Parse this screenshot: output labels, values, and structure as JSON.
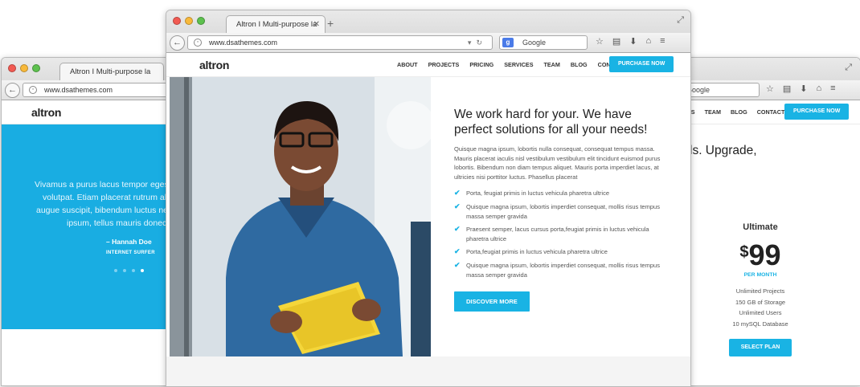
{
  "browser": {
    "tab_title": "Altron I Multi-purpose la",
    "tab_title_short": "Altron I Multi-purpose la",
    "url": "www.dsathemes.com",
    "search_placeholder": "Google",
    "search_engine_icon": "google-icon"
  },
  "site": {
    "logo": "altron",
    "nav": [
      "ABOUT",
      "PROJECTS",
      "PRICING",
      "SERVICES",
      "TEAM",
      "BLOG",
      "CONTACTS"
    ],
    "nav_right_visible": [
      "ES",
      "TEAM",
      "BLOG",
      "CONTACTS"
    ],
    "purchase_label": "PURCHASE NOW",
    "accent": "#19b3e4"
  },
  "main": {
    "heading": "We work hard for your. We have perfect solutions for all your needs!",
    "paragraph": "Quisque magna ipsum, lobortis nulla consequat, consequat tempus massa. Mauris placerat iaculis nisl vestibulum vestibulum elit tincidunt euismod purus lobortis. Bibendum non diam tempus aliquet. Mauris porta imperdiet lacus, at ultricies nisi porttitor luctus. Phasellus placerat",
    "list": [
      "Porta, feugiat primis in luctus vehicula pharetra ultrice",
      "Quisque magna ipsum, lobortis imperdiet consequat, mollis risus tempus massa semper gravida",
      "Praesent semper, lacus cursus porta,feugiat primis in luctus vehicula pharetra ultrice",
      "Porta,feugiat primis in luctus vehicula pharetra ultrice",
      "Quisque magna ipsum, lobortis imperdiet consequat, mollis risus tempus massa semper gravida"
    ],
    "cta": "DISCOVER MORE"
  },
  "testimonial": {
    "lines": [
      "Vivamus a purus lacus tempor egestas",
      "volutpat. Etiam placerat rutrum aliqu",
      "augue suscipit, bibendum luctus nequ",
      "ipsum, tellus mauris donec eu"
    ],
    "author": "– Hannah Doe",
    "role": "INTERNET SURFER"
  },
  "pricing": {
    "headline": "ls. Upgrade,",
    "plan": "Ultimate",
    "currency": "$",
    "amount": "99",
    "period": "PER MONTH",
    "features": [
      "Unlimited Projects",
      "150 GB of Storage",
      "Unlimited Users",
      "10 mySQL Database"
    ],
    "select": "SELECT PLAN"
  }
}
